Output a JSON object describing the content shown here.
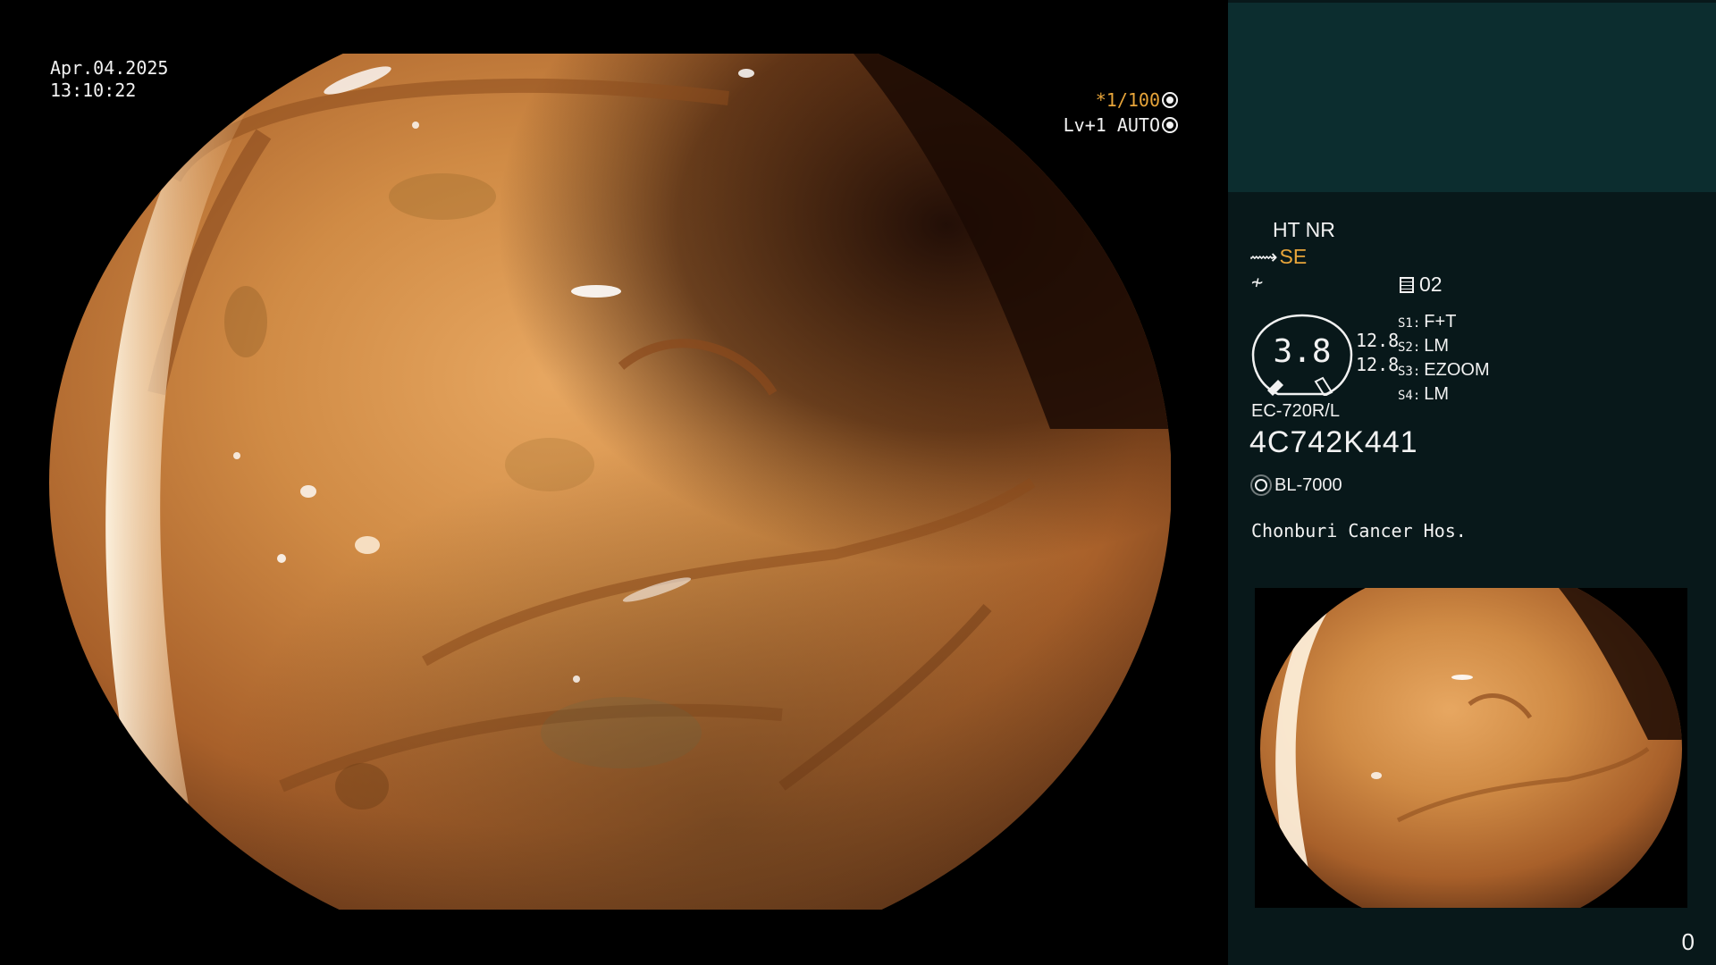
{
  "overlay": {
    "date": "Apr.04.2025",
    "time": "13:10:22",
    "shutter": "*1/100",
    "iris": "Lv+1 AUTO"
  },
  "panel": {
    "mode": "HT NR",
    "enhancement": "SE",
    "memory_slot": "02",
    "gauge_value": "3.8",
    "gauge_nums": [
      "12.8",
      "12.8"
    ],
    "scope_settings": [
      {
        "key": "S1:",
        "value": "F+T"
      },
      {
        "key": "S2:",
        "value": "LM"
      },
      {
        "key": "S3:",
        "value": "EZOOM"
      },
      {
        "key": "S4:",
        "value": "LM"
      }
    ],
    "scope_model": "EC-720R/L",
    "serial": "4C742K441",
    "light_source": "BL-7000",
    "hospital": "Chonburi Cancer Hos."
  },
  "counter": "0",
  "colors": {
    "accent": "#e8a53a",
    "panel_bg": "#08181a",
    "panel_header": "#0c2d2f",
    "tissue": "#c9833d"
  }
}
